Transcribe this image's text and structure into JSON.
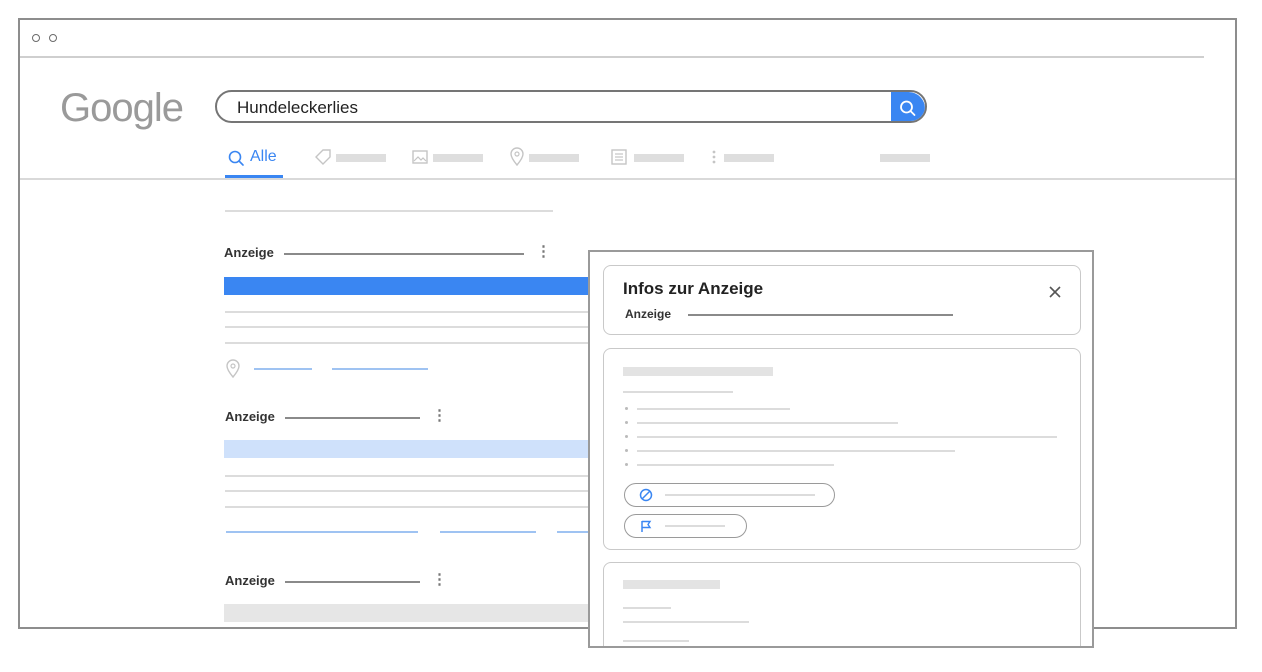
{
  "search": {
    "logo": "Google",
    "query": "Hundeleckerlies"
  },
  "tabs": {
    "active_label": "Alle"
  },
  "results": {
    "ad_label_1": "Anzeige",
    "ad_label_2": "Anzeige",
    "ad_label_3": "Anzeige"
  },
  "ad_panel": {
    "title": "Infos zur Anzeige",
    "subtitle": "Anzeige"
  },
  "colors": {
    "accent": "#3a86f2",
    "accent_light": "#cfe1fb",
    "link_line": "#9fc3f2"
  }
}
